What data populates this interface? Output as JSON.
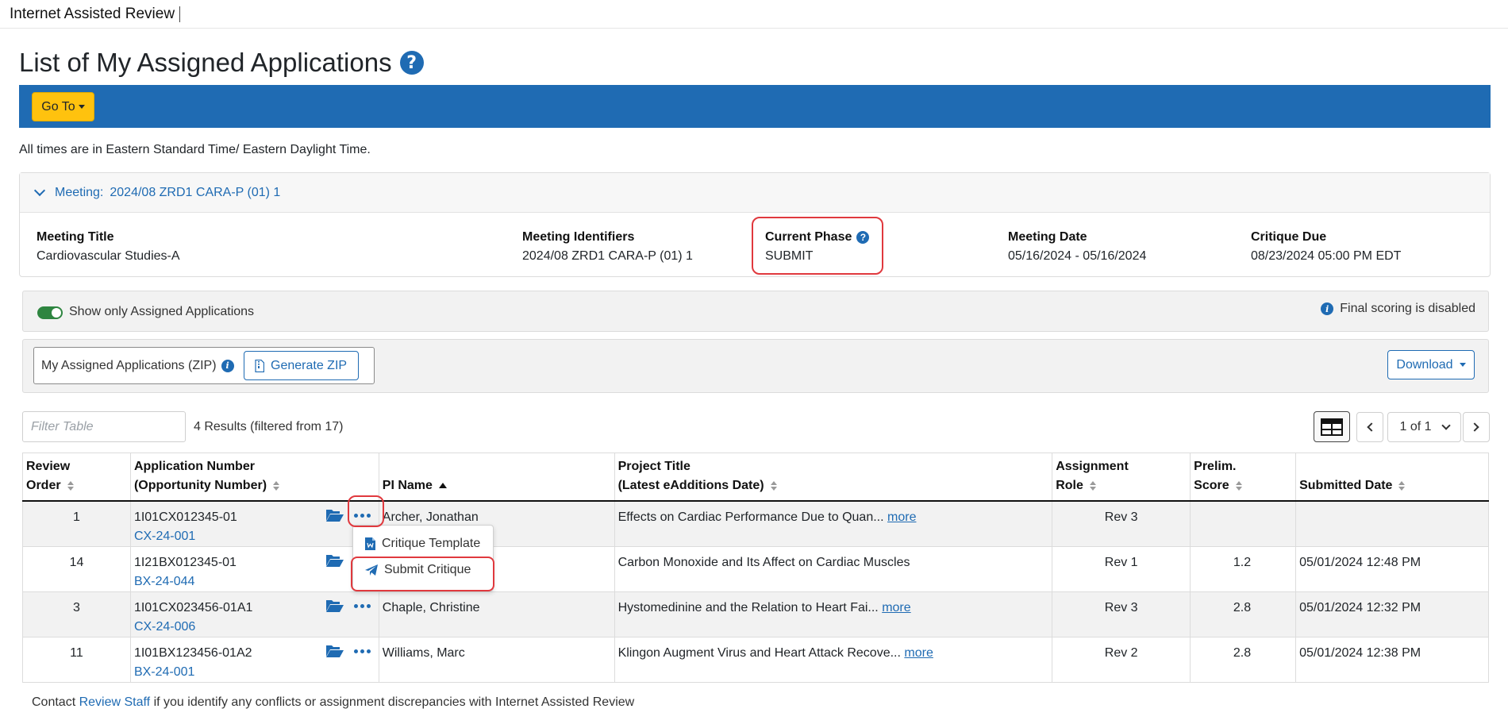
{
  "header": {
    "app_name": "Internet Assisted Review"
  },
  "page": {
    "title": "List of My Assigned Applications",
    "help_glyph": "?",
    "goto_label": "Go To",
    "timezone_note": "All times are in Eastern Standard Time/ Eastern Daylight Time."
  },
  "meeting": {
    "header_prefix": "Meeting:",
    "header_value": "2024/08 ZRD1 CARA-P (01) 1",
    "fields": {
      "title_label": "Meeting Title",
      "title_value": "Cardiovascular Studies-A",
      "identifiers_label": "Meeting Identifiers",
      "identifiers_value": "2024/08 ZRD1 CARA-P (01) 1",
      "phase_label": "Current Phase",
      "phase_value": "SUBMIT",
      "date_label": "Meeting Date",
      "date_value": "05/16/2024 - 05/16/2024",
      "critique_label": "Critique Due",
      "critique_value": "08/23/2024 05:00 PM EDT"
    }
  },
  "filters": {
    "toggle_label": "Show only Assigned Applications",
    "toggle_on": true,
    "final_scoring": "Final scoring is disabled"
  },
  "zip": {
    "label": "My Assigned Applications (ZIP)",
    "generate_label": "Generate ZIP",
    "download_label": "Download"
  },
  "table_controls": {
    "filter_placeholder": "Filter Table",
    "results_text": "4 Results (filtered from 17)",
    "page_label": "1 of 1"
  },
  "table": {
    "headers": {
      "review_order_1": "Review",
      "review_order_2": "Order",
      "app_number_1": "Application Number",
      "app_number_2": "(Opportunity Number)",
      "pi_name": "PI Name",
      "project_title_1": "Project Title",
      "project_title_2": "(Latest eAdditions Date)",
      "role_1": "Assignment",
      "role_2": "Role",
      "score_1": "Prelim.",
      "score_2": "Score",
      "submitted": "Submitted Date"
    },
    "more_label": "more",
    "rows": [
      {
        "order": "1",
        "app_number": "1I01CX012345-01",
        "opportunity": "CX-24-001",
        "pi": "Archer, Jonathan",
        "title": "Effects on Cardiac Performance Due to Quan...",
        "has_more": true,
        "role": "Rev 3",
        "score": "",
        "submitted": ""
      },
      {
        "order": "14",
        "app_number": "1I21BX012345-01",
        "opportunity": "BX-24-044",
        "pi": "",
        "title": "Carbon Monoxide and Its Affect on Cardiac Muscles",
        "has_more": false,
        "role": "Rev 1",
        "score": "1.2",
        "submitted": "05/01/2024 12:48 PM"
      },
      {
        "order": "3",
        "app_number": "1I01CX023456-01A1",
        "opportunity": "CX-24-006",
        "pi": "Chaple, Christine",
        "title": "Hystomedinine and the Relation to Heart Fai...",
        "has_more": true,
        "role": "Rev 3",
        "score": "2.8",
        "submitted": "05/01/2024 12:32 PM"
      },
      {
        "order": "11",
        "app_number": "1I01BX123456-01A2",
        "opportunity": "BX-24-001",
        "pi": "Williams, Marc",
        "title": "Klingon Augment Virus and Heart Attack Recove...",
        "has_more": true,
        "role": "Rev 2",
        "score": "2.8",
        "submitted": "05/01/2024 12:38 PM"
      }
    ]
  },
  "action_menu": {
    "items": [
      {
        "label": "Critique Template",
        "icon": "word-document-icon"
      },
      {
        "label": "Submit Critique",
        "icon": "paper-plane-icon"
      }
    ]
  },
  "footer": {
    "prefix": "Contact",
    "link": "Review Staff",
    "suffix": "if you identify any conflicts or assignment discrepancies with Internet Assisted Review"
  },
  "colors": {
    "brand_blue": "#1f6bb3",
    "goto_yellow": "#ffc20e",
    "highlight_red": "#e0393e",
    "toggle_green": "#2e8540"
  }
}
